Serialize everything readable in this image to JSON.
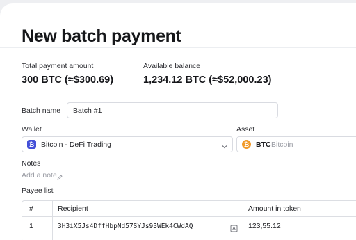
{
  "page": {
    "title": "New batch payment"
  },
  "summary": {
    "total_label": "Total payment amount",
    "total_value": "300 BTC (≈$300.69)",
    "balance_label": "Available balance",
    "balance_value": "1,234.12 BTC (≈$52,000.23)"
  },
  "form": {
    "batch_name_label": "Batch name",
    "batch_name_value": "Batch #1",
    "wallet_label": "Wallet",
    "wallet_value": "Bitcoin - DeFi Trading",
    "asset_label": "Asset",
    "asset_symbol": "BTC",
    "asset_name": "Bitcoin",
    "notes_label": "Notes",
    "notes_placeholder": "Add a note"
  },
  "payees": {
    "label": "Payee list",
    "columns": [
      "#",
      "Recipient",
      "Amount in token"
    ],
    "rows": [
      {
        "index": "1",
        "recipient": "3H3iX5Js4DffHbpNd57SYJs93WEk4CWdAQ",
        "amount": "123,55.12"
      }
    ]
  },
  "colors": {
    "wallet_icon_bg": "#4450d8",
    "btc_orange": "#f19a2a",
    "input_border": "#d9dbe1"
  },
  "icons": {
    "wallet": "wallet-bitcoin-icon",
    "chevron": "chevron-down-icon",
    "asset": "bitcoin-icon",
    "pencil": "pencil-icon",
    "address_book": "address-book-icon"
  }
}
